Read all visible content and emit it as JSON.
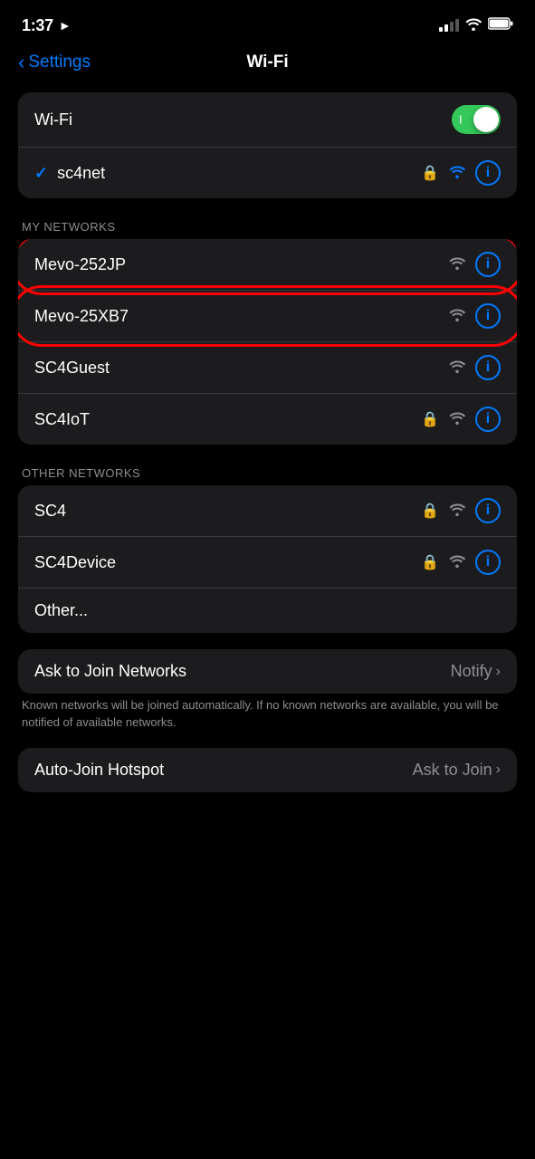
{
  "statusBar": {
    "time": "1:37",
    "locationIcon": "▶",
    "signalBars": [
      3,
      4
    ],
    "wifiOn": true,
    "batteryFull": true
  },
  "nav": {
    "backLabel": "Settings",
    "title": "Wi-Fi"
  },
  "wifiToggle": {
    "label": "Wi-Fi",
    "state": "on",
    "stateLabel": "I"
  },
  "connectedNetwork": {
    "name": "sc4net",
    "checkmark": "✓",
    "lock": true,
    "info": "i"
  },
  "myNetworks": {
    "sectionLabel": "MY NETWORKS",
    "items": [
      {
        "name": "Mevo-252JP",
        "lock": false,
        "wifi": true,
        "info": "i",
        "annotated": true
      },
      {
        "name": "Mevo-25XB7",
        "lock": false,
        "wifi": true,
        "info": "i",
        "annotated": true
      },
      {
        "name": "SC4Guest",
        "lock": false,
        "wifi": true,
        "info": "i",
        "annotated": false
      },
      {
        "name": "SC4IoT",
        "lock": true,
        "wifi": true,
        "info": "i",
        "annotated": false
      }
    ]
  },
  "otherNetworks": {
    "sectionLabel": "OTHER NETWORKS",
    "items": [
      {
        "name": "SC4",
        "lock": true,
        "wifi": true,
        "info": "i"
      },
      {
        "name": "SC4Device",
        "lock": true,
        "wifi": true,
        "info": "i"
      },
      {
        "name": "Other...",
        "lock": false,
        "wifi": false,
        "info": false
      }
    ]
  },
  "askToJoin": {
    "label": "Ask to Join Networks",
    "value": "Notify",
    "description": "Known networks will be joined automatically. If no known networks are available, you will be notified of available networks."
  },
  "autoJoin": {
    "label": "Auto-Join Hotspot",
    "value": "Ask to Join"
  }
}
